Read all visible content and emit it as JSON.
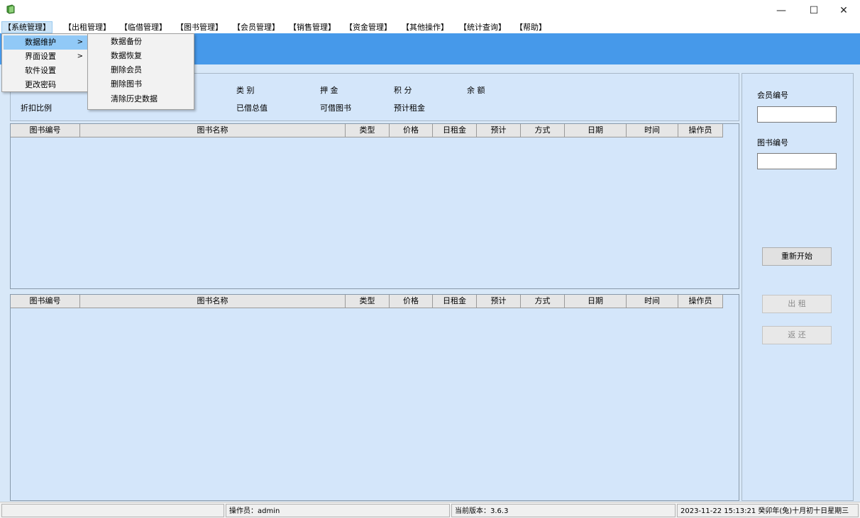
{
  "window": {
    "minimize_glyph": "—",
    "maximize_glyph": "☐",
    "close_glyph": "✕"
  },
  "menubar": {
    "items": [
      "【系统管理】",
      "【出租管理】",
      "【临借管理】",
      "【图书管理】",
      "【会员管理】",
      "【销售管理】",
      "【资金管理】",
      "【其他操作】",
      "【统计查询】",
      "【帮助】"
    ]
  },
  "dropdown": {
    "items": [
      "数据维护",
      "界面设置",
      "软件设置",
      "更改密码"
    ],
    "arrow": ">"
  },
  "submenu": {
    "items": [
      "数据备份",
      "数据恢复",
      "删除会员",
      "删除图书",
      "清除历史数据"
    ]
  },
  "info": {
    "category": "类  别",
    "deposit": "押  金",
    "points": "积 分",
    "balance": "余 额",
    "discount": "折扣比例",
    "borrowed_total": "已借总值",
    "borrowable": "可借图书",
    "estimated_rent": "预计租金"
  },
  "grid": {
    "columns": [
      "图书编号",
      "图书名称",
      "类型",
      "价格",
      "日租金",
      "预计",
      "方式",
      "日期",
      "时间",
      "操作员"
    ]
  },
  "side": {
    "member_id_label": "会员编号",
    "book_id_label": "图书编号",
    "restart_label": "重新开始",
    "rent_label": "出  租",
    "return_label": "返  还"
  },
  "status": {
    "operator": "操作员：admin",
    "version": "当前版本：3.6.3",
    "datetime": "2023-11-22 15:13:21 癸卯年(兔)十月初十日星期三"
  },
  "colors": {
    "banner": "#4699ea",
    "panel": "#d4e6fa",
    "menu_highlight": "#91c9f7"
  }
}
